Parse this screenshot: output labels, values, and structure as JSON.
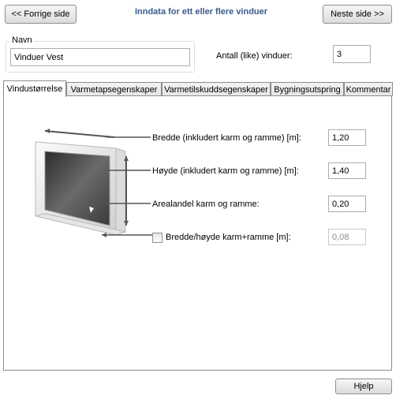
{
  "header": {
    "prev_label": "<< Forrige side",
    "title": "Inndata for ett eller flere vinduer",
    "next_label": "Neste side >>"
  },
  "name_group": {
    "legend": "Navn",
    "value": "Vinduer Vest"
  },
  "count": {
    "label": "Antall (like) vinduer:",
    "value": "3"
  },
  "tabs": [
    {
      "label": "Vindustørrelse",
      "active": true
    },
    {
      "label": "Varmetapsegenskaper",
      "active": false
    },
    {
      "label": "Varmetilskuddsegenskaper",
      "active": false
    },
    {
      "label": "Bygningsutspring",
      "active": false
    },
    {
      "label": "Kommentar",
      "active": false
    }
  ],
  "fields": {
    "width": {
      "label": "Bredde (inkludert karm og ramme) [m]:",
      "value": "1,20"
    },
    "height": {
      "label": "Høyde (inkludert karm og ramme) [m]:",
      "value": "1,40"
    },
    "frame_fraction": {
      "label": "Arealandel karm og ramme:",
      "value": "0,20"
    },
    "frame_width": {
      "label": "Bredde/høyde karm+ramme [m]:",
      "value": "0,08",
      "checked": false,
      "enabled": false
    }
  },
  "footer": {
    "help_label": "Hjelp"
  },
  "colors": {
    "title": "#3a5b8c",
    "border": "#898c95"
  }
}
